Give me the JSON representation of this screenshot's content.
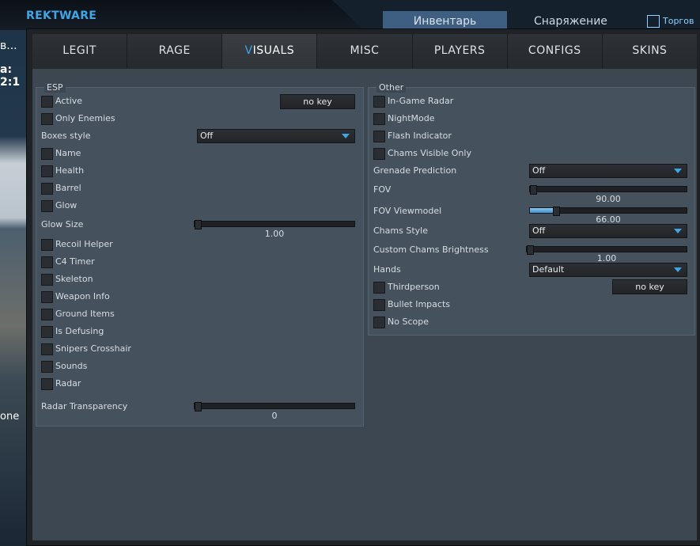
{
  "background": {
    "left_text_1": "в...",
    "left_text_2": "а: 2:1",
    "left_text_3": "one"
  },
  "topbar": {
    "brand": "REKTWARE",
    "nav_inventory": "Инвентарь",
    "nav_equipment": "Снаряжение",
    "nav_trade": "Торгов"
  },
  "tabs": [
    "LEGIT",
    "RAGE",
    "VISUALS",
    "MISC",
    "PLAYERS",
    "CONFIGS",
    "SKINS"
  ],
  "active_tab": "VISUALS",
  "esp": {
    "title": "ESP",
    "active": "Active",
    "active_key": "no key",
    "only_enemies": "Only Enemies",
    "boxes_style_label": "Boxes style",
    "boxes_style_value": "Off",
    "name": "Name",
    "health": "Health",
    "barrel": "Barrel",
    "glow": "Glow",
    "glow_size_label": "Glow Size",
    "glow_size_value": "1.00",
    "recoil_helper": "Recoil Helper",
    "c4_timer": "C4 Timer",
    "skeleton": "Skeleton",
    "weapon_info": "Weapon Info",
    "ground_items": "Ground Items",
    "is_defusing": "Is Defusing",
    "snipers_crosshair": "Snipers Crosshair",
    "sounds": "Sounds",
    "radar": "Radar",
    "radar_transparency_label": "Radar Transparency",
    "radar_transparency_value": "0"
  },
  "other": {
    "title": "Other",
    "in_game_radar": "In-Game Radar",
    "nightmode": "NightMode",
    "flash_indicator": "Flash Indicator",
    "chams_visible_only": "Chams Visible Only",
    "grenade_prediction_label": "Grenade Prediction",
    "grenade_prediction_value": "Off",
    "fov_label": "FOV",
    "fov_value": "90.00",
    "fov_fill": 0,
    "fov_viewmodel_label": "FOV Viewmodel",
    "fov_viewmodel_value": "66.00",
    "fov_viewmodel_fill": 0.15,
    "chams_style_label": "Chams Style",
    "chams_style_value": "Off",
    "custom_chams_brightness_label": "Custom Chams Brightness",
    "custom_chams_brightness_value": "1.00",
    "hands_label": "Hands",
    "hands_value": "Default",
    "thirdperson": "Thirdperson",
    "thirdperson_key": "no key",
    "bullet_impacts": "Bullet Impacts",
    "no_scope": "No Scope"
  },
  "colors": {
    "accent": "#3fa6e6",
    "panel": "#45515c"
  }
}
